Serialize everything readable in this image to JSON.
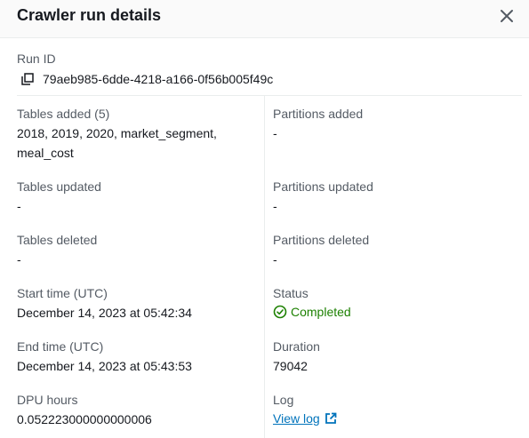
{
  "modal": {
    "title": "Crawler run details"
  },
  "run": {
    "run_id_label": "Run ID",
    "run_id": "79aeb985-6dde-4218-a166-0f56b005f49c"
  },
  "details": {
    "tables_added_label": "Tables added (5)",
    "tables_added_line1": "2018, 2019, 2020, market_segment,",
    "tables_added_line2": "meal_cost",
    "partitions_added_label": "Partitions added",
    "partitions_added": "-",
    "tables_updated_label": "Tables updated",
    "tables_updated": "-",
    "partitions_updated_label": "Partitions updated",
    "partitions_updated": "-",
    "tables_deleted_label": "Tables deleted",
    "tables_deleted": "-",
    "partitions_deleted_label": "Partitions deleted",
    "partitions_deleted": "-",
    "start_time_label": "Start time (UTC)",
    "start_time": "December 14, 2023 at 05:42:34",
    "status_label": "Status",
    "status": "Completed",
    "end_time_label": "End time (UTC)",
    "end_time": "December 14, 2023 at 05:43:53",
    "duration_label": "Duration",
    "duration": "79042",
    "dpu_hours_label": "DPU hours",
    "dpu_hours": "0.052223000000000006",
    "log_label": "Log",
    "log_link": "View log"
  },
  "colors": {
    "success": "#1d8102",
    "link": "#0073bb",
    "label": "#545b64",
    "text": "#16191f"
  },
  "icons": [
    "close-icon",
    "copy-icon",
    "check-circle-icon",
    "external-link-icon"
  ]
}
